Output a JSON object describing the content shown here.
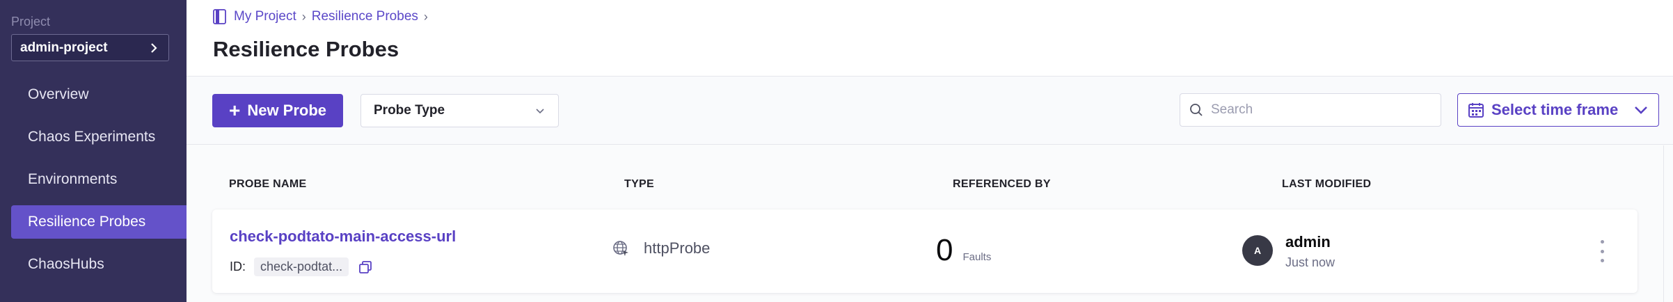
{
  "sidebar": {
    "project_label": "Project",
    "project_name": "admin-project",
    "items": [
      {
        "label": "Overview"
      },
      {
        "label": "Chaos Experiments"
      },
      {
        "label": "Environments"
      },
      {
        "label": "Resilience Probes",
        "active": true
      },
      {
        "label": "ChaosHubs"
      }
    ]
  },
  "breadcrumb": {
    "items": [
      "My Project",
      "Resilience Probes"
    ]
  },
  "page": {
    "title": "Resilience Probes"
  },
  "toolbar": {
    "new_probe_label": "New Probe",
    "probe_type_label": "Probe Type",
    "search_placeholder": "Search",
    "timeframe_label": "Select time frame"
  },
  "table": {
    "columns": [
      "PROBE NAME",
      "TYPE",
      "REFERENCED BY",
      "LAST MODIFIED"
    ],
    "rows": [
      {
        "name": "check-podtato-main-access-url",
        "id_label": "ID:",
        "id_value": "check-podtat...",
        "type": "httpProbe",
        "type_icon": "globe-icon",
        "referenced_count": "0",
        "referenced_label": "Faults",
        "avatar_initial": "A",
        "modified_by": "admin",
        "modified_time": "Just now"
      }
    ]
  },
  "colors": {
    "sidebar_bg": "#34305a",
    "accent": "#5941c4",
    "active_nav": "#6452c9"
  }
}
